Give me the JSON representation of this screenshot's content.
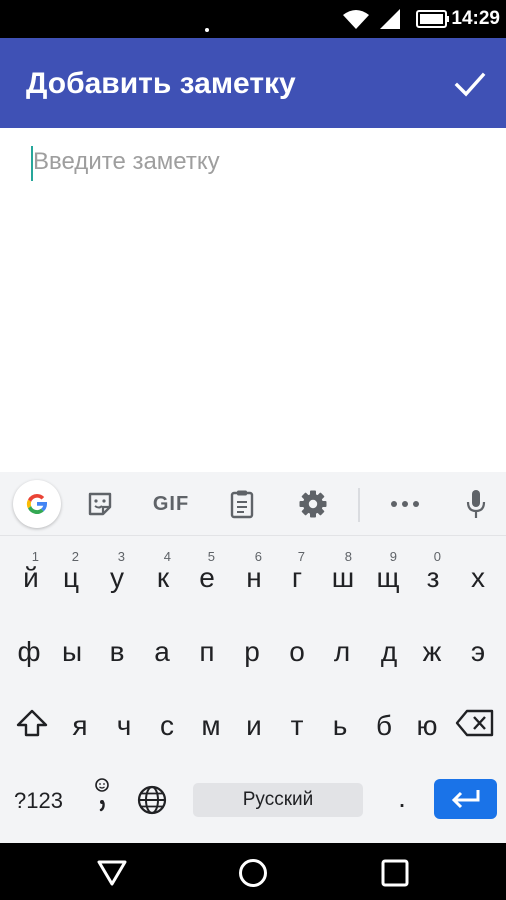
{
  "status_bar": {
    "time": "14:29",
    "icons": [
      "wifi-icon",
      "cell-signal-icon",
      "battery-icon"
    ]
  },
  "app_bar": {
    "title": "Добавить заметку",
    "confirm_icon": "check-icon",
    "color": "#3f51b5"
  },
  "note": {
    "placeholder": "Введите заметку",
    "value": ""
  },
  "keyboard": {
    "toolbar": {
      "gif_label": "GIF"
    },
    "row1": {
      "keys": [
        "й",
        "ц",
        "у",
        "к",
        "е",
        "н",
        "г",
        "ш",
        "щ",
        "з",
        "х"
      ],
      "hints": [
        "1",
        "2",
        "3",
        "4",
        "5",
        "6",
        "7",
        "8",
        "9",
        "0",
        ""
      ]
    },
    "row2": {
      "keys": [
        "ф",
        "ы",
        "в",
        "а",
        "п",
        "р",
        "о",
        "л",
        "д",
        "ж",
        "э"
      ]
    },
    "row3": {
      "keys": [
        "я",
        "ч",
        "с",
        "м",
        "и",
        "т",
        "ь",
        "б",
        "ю"
      ]
    },
    "bottom": {
      "symbols_label": "?123",
      "period_label": ".",
      "space_label": "Русский"
    },
    "accent": "#1a73e8"
  }
}
